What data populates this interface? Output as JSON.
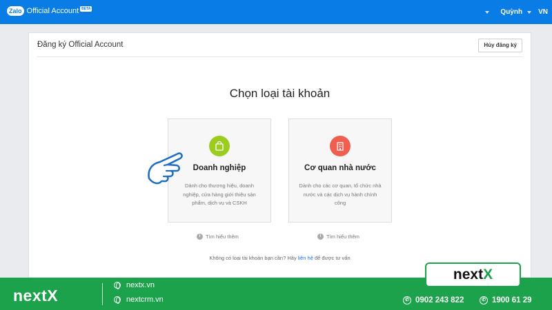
{
  "topbar": {
    "logo_mark": "Zalo",
    "app_title": "Official Account",
    "beta_badge": "BETA",
    "user_name": "Quỳnh",
    "lang": "VN"
  },
  "page": {
    "title": "Đăng ký Official Account",
    "cancel_button": "Hủy đăng ký",
    "heading": "Chọn loại tài khoản"
  },
  "cards": [
    {
      "title": "Doanh nghiệp",
      "desc": "Dành cho thương hiệu, doanh nghiệp, cửa hàng giới thiệu sản phẩm, dịch vụ và CSKH",
      "learn_more": "Tìm hiểu thêm",
      "icon": "shopping-bag-icon",
      "color": "#9bcc1f"
    },
    {
      "title": "Cơ quan nhà nước",
      "desc": "Dành cho các cơ quan, tổ chức nhà nước và các dịch vụ hành chính công",
      "learn_more": "Tìm hiểu thêm",
      "icon": "building-icon",
      "color": "#ef5e4f"
    }
  ],
  "footer_note": {
    "prefix": "Không có loại tài khoản bạn cần? Hãy ",
    "link": "liên hệ",
    "suffix": " để được tư vấn"
  },
  "banner": {
    "brand_prefix": "next",
    "brand_suffix": "X",
    "site1": "nextx.vn",
    "site2": "nextcrm.vn",
    "phone1": "0902 243 822",
    "phone2": "1900 61 29",
    "accent": "#1ba24a"
  }
}
